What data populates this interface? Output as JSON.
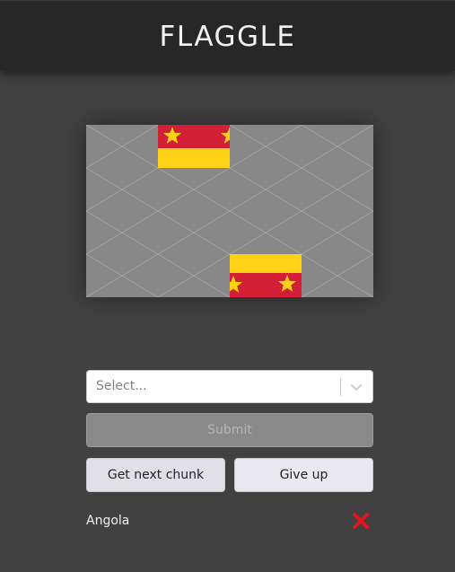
{
  "header": {
    "title": "FLAGGLE"
  },
  "flag_board": {
    "colors": {
      "board": "#888888",
      "grid": "#a2a2a2",
      "red": "#d21f35",
      "yellow": "#fcd116",
      "star": "#fcd116"
    },
    "chunks_revealed": 2
  },
  "select": {
    "placeholder": "Select...",
    "icon": "chevron-down-icon"
  },
  "buttons": {
    "submit_label": "Submit",
    "next_chunk_label": "Get next chunk",
    "give_up_label": "Give up"
  },
  "guesses": [
    {
      "country": "Angola",
      "result_icon": "wrong-x-icon",
      "result_color": "#e0141e"
    }
  ]
}
